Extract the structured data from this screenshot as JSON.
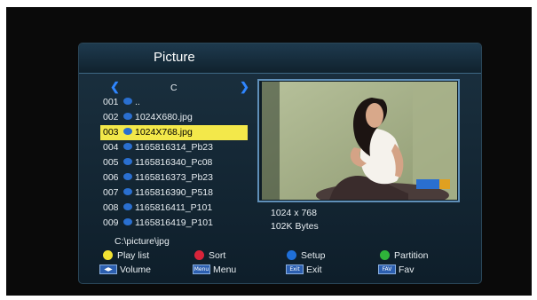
{
  "title": "Picture",
  "drive": "C",
  "files": [
    {
      "num": "001",
      "name": ".."
    },
    {
      "num": "002",
      "name": "1024X680.jpg"
    },
    {
      "num": "003",
      "name": "1024X768.jpg"
    },
    {
      "num": "004",
      "name": "1165816314_Pb23"
    },
    {
      "num": "005",
      "name": "1165816340_Pc08"
    },
    {
      "num": "006",
      "name": "1165816373_Pb23"
    },
    {
      "num": "007",
      "name": "1165816390_P518"
    },
    {
      "num": "008",
      "name": "1165816411_P101"
    },
    {
      "num": "009",
      "name": "1165816419_P101"
    }
  ],
  "selected_index": 2,
  "preview": {
    "resolution": "1024 x 768",
    "size": "102K Bytes"
  },
  "path": "C:\\picture\\jpg",
  "hints": {
    "play_list": "Play list",
    "sort": "Sort",
    "setup": "Setup",
    "partition": "Partition",
    "volume": "Volume",
    "menu": "Menu",
    "exit": "Exit",
    "fav": "Fav"
  },
  "colors": {
    "yellow": "#f2e233",
    "red": "#d8243a",
    "blue": "#1f6fd8",
    "green": "#2fb43a",
    "highlight": "#f3e84a"
  },
  "icons": {
    "nav_left": "chevron-left-icon",
    "nav_right": "chevron-right-icon",
    "file": "picture-file-icon"
  }
}
